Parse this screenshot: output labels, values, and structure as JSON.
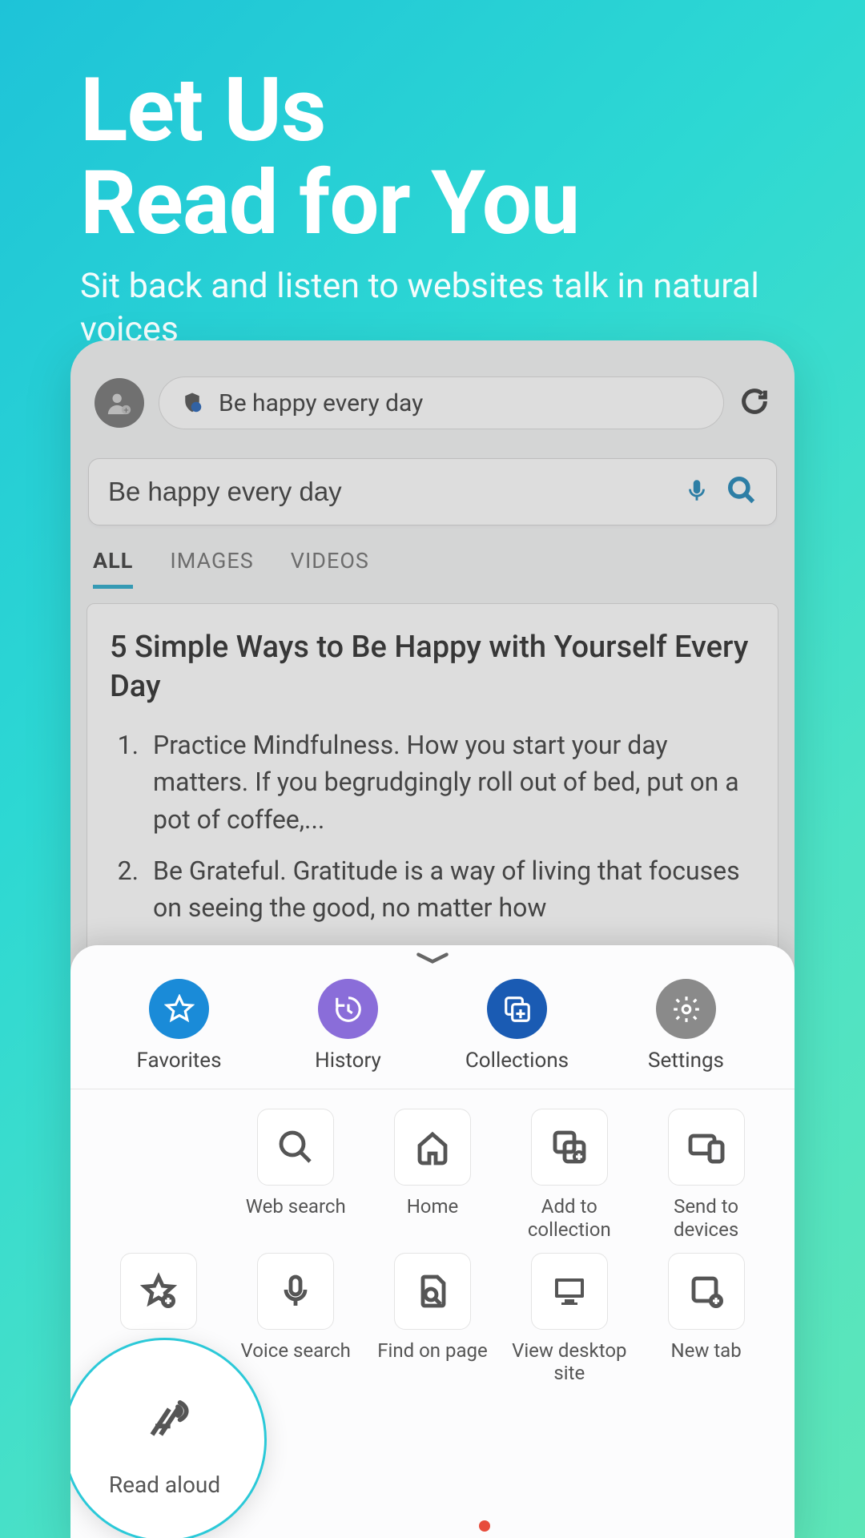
{
  "hero": {
    "title_line1": "Let Us",
    "title_line2": "Read for You",
    "subtitle": "Sit back and listen to websites talk in natural voices"
  },
  "browser": {
    "address_text": "Be happy every day",
    "search_value": "Be happy every day",
    "tabs": {
      "all": "ALL",
      "images": "IMAGES",
      "videos": "VIDEOS"
    },
    "article": {
      "title": "5 Simple Ways to Be Happy with Yourself Every Day",
      "item1": "Practice Mindfulness. How you start your day matters. If you begrudgingly roll out of bed, put on a pot of coffee,...",
      "item2": "Be Grateful. Gratitude is a way of living that focuses on seeing the good, no matter how"
    }
  },
  "sheet": {
    "top": {
      "favorites": "Favorites",
      "history": "History",
      "collections": "Collections",
      "settings": "Settings"
    },
    "highlight": {
      "label": "Read aloud"
    },
    "tiles": {
      "read_aloud": "Read aloud",
      "web_search": "Web search",
      "home": "Home",
      "add_collection": "Add to collection",
      "send_devices": "Send to devices",
      "add_favorites": "Add to favorites",
      "voice_search": "Voice search",
      "find_page": "Find on page",
      "view_desktop": "View desktop site",
      "new_tab": "New tab"
    }
  }
}
